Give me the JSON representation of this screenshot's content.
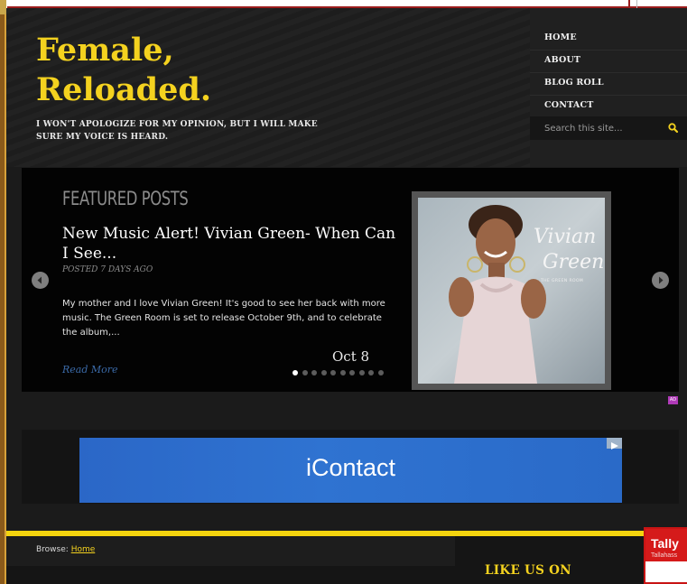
{
  "site": {
    "title_line1": "Female,",
    "title_line2": "Reloaded.",
    "tagline": "I WON'T APOLOGIZE FOR MY OPINION, BUT I WILL MAKE SURE MY VOICE IS HEARD."
  },
  "nav": {
    "items": [
      "HOME",
      "ABOUT",
      "BLOG ROLL",
      "CONTACT"
    ],
    "search_placeholder": "Search this site..."
  },
  "featured": {
    "heading": "FEATURED POSTS",
    "post_title": "New Music Alert! Vivian Green- When Can I See...",
    "meta": "POSTED 7 DAYS AGO",
    "excerpt": "My mother and I love Vivian Green! It's good to see her back with more music. The Green Room is set to release October 9th, and to celebrate the album,...",
    "date": "Oct 8",
    "read_more": "Read More",
    "slide_count": 10,
    "active_slide": 1,
    "album_art": {
      "artist_line1": "Vivian",
      "artist_line2": "Green",
      "album": "THE GREEN ROOM"
    }
  },
  "ad": {
    "badge": "AD",
    "brand": "iContact"
  },
  "breadcrumb": {
    "prefix": "Browse:",
    "link": "Home"
  },
  "sidebar": {
    "like_heading": "LIKE US ON"
  },
  "widget": {
    "title": "Tally",
    "subtitle": "Tallahass"
  },
  "colors": {
    "accent_yellow": "#f4d21f",
    "background": "#1b1b1b",
    "link_blue": "#3b6aa8",
    "ad_blue": "#2f73d1",
    "widget_red": "#d51a1a"
  },
  "icons": {
    "search": "search-icon",
    "prev": "chevron-left-icon",
    "next": "chevron-right-icon",
    "ad_close": "ad-choices-icon"
  }
}
